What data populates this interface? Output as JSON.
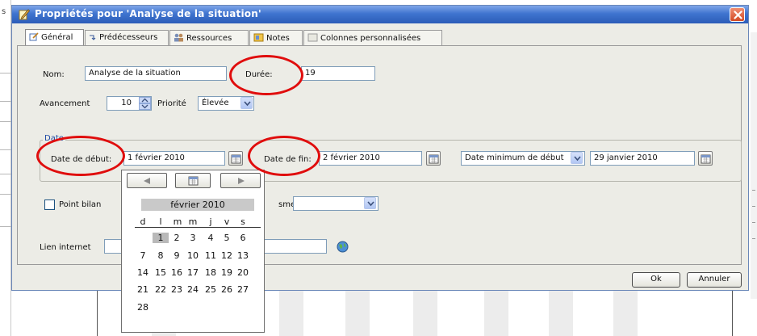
{
  "background": {
    "left_mark": "s"
  },
  "dialog": {
    "title": "Propriétés pour 'Analyse de la situation'",
    "tabs": [
      {
        "label": "Général"
      },
      {
        "label": "Prédécesseurs"
      },
      {
        "label": "Ressources"
      },
      {
        "label": "Notes"
      },
      {
        "label": "Colonnes personnalisées"
      }
    ],
    "general": {
      "nom_label": "Nom:",
      "nom_value": "Analyse de la situation",
      "duree_label": "Durée:",
      "duree_value": "19",
      "avancement_label": "Avancement",
      "avancement_value": "10",
      "priorite_label": "Priorité",
      "priorite_value": "Élevée",
      "date_group_label": "Date",
      "date_debut_label": "Date de début:",
      "date_debut_value": "1 février 2010",
      "date_fin_label": "Date de fin:",
      "date_fin_value": "2 février 2010",
      "contrainte_value": "Date minimum de début",
      "contrainte_date_value": "29 janvier 2010",
      "point_bilan_label": "Point bilan",
      "mecanisme_label_fragment": "sme",
      "lien_internet_label": "Lien internet"
    },
    "buttons": {
      "ok": "Ok",
      "cancel": "Annuler"
    }
  },
  "calendar": {
    "month_label": "février 2010",
    "day_headers": [
      "d",
      "l",
      "m",
      "m",
      "j",
      "v",
      "s"
    ],
    "weeks": [
      [
        "",
        "1",
        "2",
        "3",
        "4",
        "5",
        "6"
      ],
      [
        "7",
        "8",
        "9",
        "10",
        "11",
        "12",
        "13"
      ],
      [
        "14",
        "15",
        "16",
        "17",
        "18",
        "19",
        "20"
      ],
      [
        "21",
        "22",
        "23",
        "24",
        "25",
        "26",
        "27"
      ],
      [
        "28",
        "",
        "",
        "",
        "",
        "",
        ""
      ]
    ],
    "selected_day": "1"
  },
  "colors": {
    "titlebar": "#2c5cb8",
    "annotation": "#e00d0d",
    "selection": "#b9b9b9"
  }
}
